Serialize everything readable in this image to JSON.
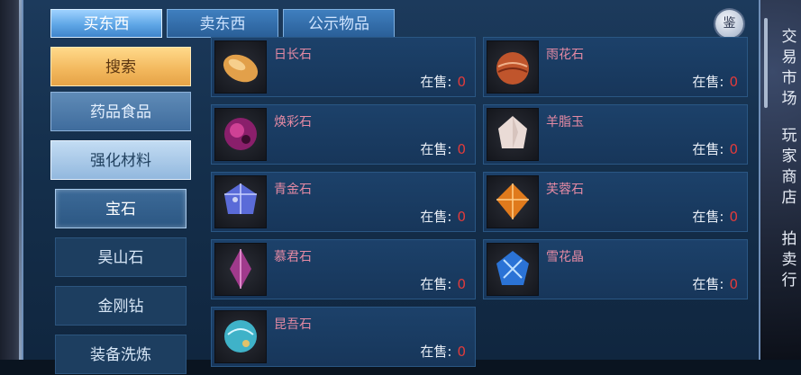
{
  "tabs": [
    {
      "label": "买东西",
      "active": true
    },
    {
      "label": "卖东西",
      "active": false
    },
    {
      "label": "公示物品",
      "active": false
    }
  ],
  "appraise_label": "鉴",
  "sidebar": {
    "search": "搜索",
    "categories": [
      "药品食品",
      "强化材料"
    ],
    "subcategories": [
      "宝石",
      "昊山石",
      "金刚钻",
      "装备洗炼"
    ]
  },
  "sale_prefix": "在售:",
  "items": [
    {
      "name": "日长石",
      "count": "0",
      "icon": "sunstone-icon",
      "color": "#e2a04a"
    },
    {
      "name": "雨花石",
      "count": "0",
      "icon": "rain-pebble-icon",
      "color": "#c0552c"
    },
    {
      "name": "焕彩石",
      "count": "0",
      "icon": "radiant-gem-icon",
      "color": "#8a1f6b"
    },
    {
      "name": "羊脂玉",
      "count": "0",
      "icon": "mutton-fat-jade-icon",
      "color": "#eadbd6"
    },
    {
      "name": "青金石",
      "count": "0",
      "icon": "lapis-icon",
      "color": "#5a6bd8"
    },
    {
      "name": "芙蓉石",
      "count": "0",
      "icon": "rose-quartz-icon",
      "color": "#e07a1c"
    },
    {
      "name": "慕君石",
      "count": "0",
      "icon": "mujun-crystal-icon",
      "color": "#a03a8c"
    },
    {
      "name": "雪花晶",
      "count": "0",
      "icon": "snowflake-crystal-icon",
      "color": "#2b73d6"
    },
    {
      "name": "昆吾石",
      "count": "0",
      "icon": "kunwu-orb-icon",
      "color": "#3fb2c8"
    }
  ],
  "right_panel": {
    "market": "交易市场",
    "shop": "玩家商店",
    "auction": "拍卖行"
  }
}
